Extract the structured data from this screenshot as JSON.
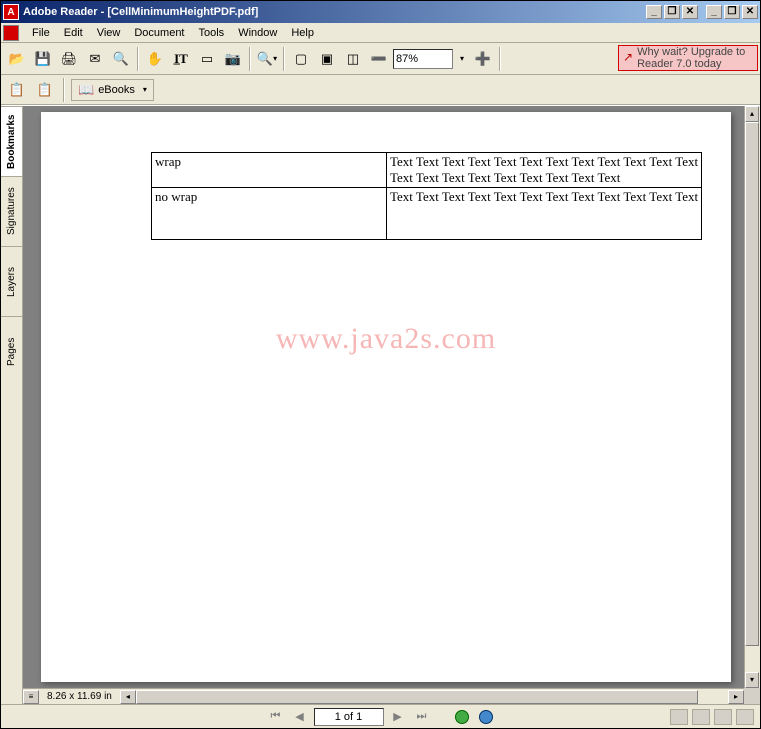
{
  "title": "Adobe Reader - [CellMinimumHeightPDF.pdf]",
  "menu": [
    "File",
    "Edit",
    "View",
    "Document",
    "Tools",
    "Window",
    "Help"
  ],
  "toolbar2": {
    "ebooks": "eBooks"
  },
  "zoom": "87%",
  "upgrade": "Why wait? Upgrade to Reader 7.0 today",
  "sidetabs": [
    "Bookmarks",
    "Signatures",
    "Layers",
    "Pages"
  ],
  "status_dim": "8.26 x 11.69 in",
  "page_indicator": "1 of 1",
  "watermark": "www.java2s.com",
  "table": {
    "rows": [
      {
        "label": "wrap",
        "text": "Text Text Text Text Text Text Text Text Text Text Text Text Text Text Text Text Text Text Text Text Text"
      },
      {
        "label": "no wrap",
        "text": "Text Text Text Text Text Text Text Text Text Text Text Text"
      }
    ]
  }
}
